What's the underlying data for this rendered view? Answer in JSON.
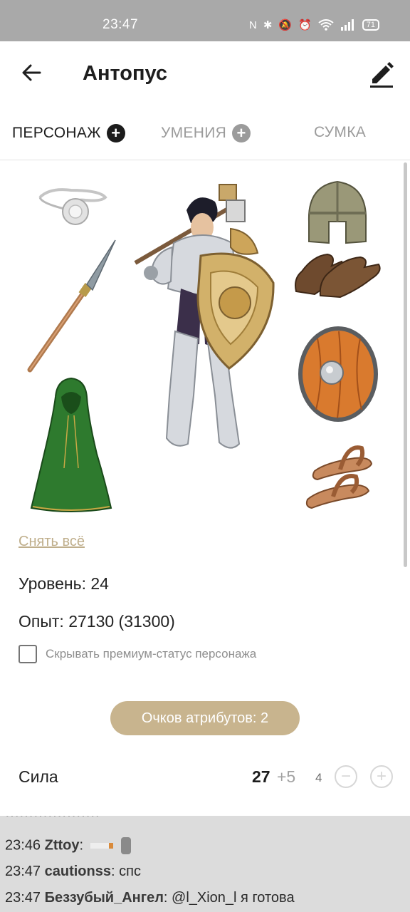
{
  "status_bar": {
    "time": "23:47",
    "battery": "71"
  },
  "app_bar": {
    "title": "Антопус"
  },
  "tabs": [
    {
      "label": "ПЕРСОНАЖ",
      "plus": "+"
    },
    {
      "label": "УМЕНИЯ",
      "plus": "+"
    },
    {
      "label": "СУМКА"
    }
  ],
  "equipment": {
    "slots": [
      "amulet-icon",
      "spear-icon",
      "cloak-icon",
      "helmet-icon",
      "gloves-icon",
      "round-shield-icon",
      "sandals-icon"
    ],
    "character": "armored-knight-figure"
  },
  "character": {
    "remove_all": "Снять всё",
    "level": "Уровень: 24",
    "experience": "Опыт: 27130 (31300)",
    "hide_premium_label": "Скрывать премиум-статус персонажа",
    "attribute_points": "Очков атрибутов: 2"
  },
  "attributes": [
    {
      "name": "Сила",
      "value": "27",
      "bonus": "+5",
      "cost": "4",
      "minus": "−",
      "plus": "+"
    }
  ],
  "chat": [
    {
      "time": "23:46",
      "user": "Zttoy",
      "sep": ":",
      "text": ""
    },
    {
      "time": "23:47",
      "user": "cautionss",
      "sep": ":",
      "text": "спс"
    },
    {
      "time": "23:47",
      "user": "Беззубый_Ангел",
      "sep": ":",
      "text": "@l_Xion_l я готова"
    }
  ],
  "colors": {
    "accent": "#c8b48e",
    "status_bar": "#a9a9a9",
    "link": "#bfae8b"
  }
}
